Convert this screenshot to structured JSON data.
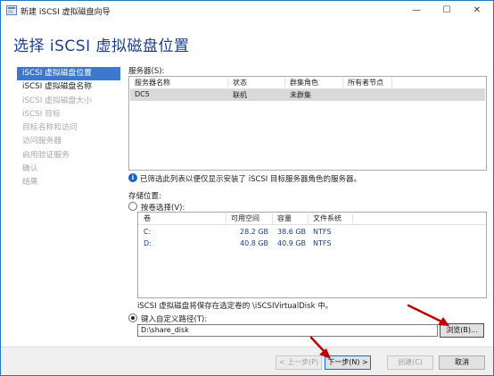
{
  "window": {
    "title": "新建 iSCSI 虚拟磁盘向导",
    "minimize_glyph": "—",
    "maximize_glyph": "☐",
    "close_glyph": "✕"
  },
  "page_title": "选择 iSCSI 虚拟磁盘位置",
  "nav": {
    "items": [
      {
        "label": "iSCSI 虚拟磁盘位置",
        "state": "active"
      },
      {
        "label": "iSCSI 虚拟磁盘名称",
        "state": "enabled"
      },
      {
        "label": "iSCSI 虚拟磁盘大小",
        "state": "disabled"
      },
      {
        "label": "iSCSI 目标",
        "state": "disabled"
      },
      {
        "label": "目标名称和访问",
        "state": "disabled"
      },
      {
        "label": "访问服务器",
        "state": "disabled"
      },
      {
        "label": "启用验证服务",
        "state": "disabled"
      },
      {
        "label": "确认",
        "state": "disabled"
      },
      {
        "label": "结果",
        "state": "disabled"
      }
    ]
  },
  "servers": {
    "label": "服务器(S):",
    "columns": [
      "服务器名称",
      "状态",
      "群集角色",
      "所有者节点"
    ],
    "rows": [
      [
        "DC5",
        "联机",
        "未群集",
        ""
      ]
    ],
    "info_text": "已筛选此列表以便仅显示安装了 iSCSI 目标服务器角色的服务器。"
  },
  "storage": {
    "label": "存储位置:",
    "by_volume_label": "按卷选择(V):",
    "by_volume_selected": false,
    "volume_columns": [
      "卷",
      "可用空间",
      "容量",
      "文件系统"
    ],
    "volumes": [
      [
        "C:",
        "28.2 GB",
        "38.6 GB",
        "NTFS"
      ],
      [
        "D:",
        "40.8 GB",
        "40.9 GB",
        "NTFS"
      ]
    ],
    "volume_note": "iSCSI 虚拟磁盘将保存在选定卷的 \\iSCSIVirtualDisk 中。",
    "custom_path_label": "键入自定义路径(T):",
    "custom_path_selected": true,
    "custom_path_value": "D:\\share_disk",
    "browse_label": "浏览(B)..."
  },
  "buttons": {
    "prev": "< 上一步(P)",
    "next": "下一步(N) >",
    "create": "创建(C)",
    "cancel": "取消"
  },
  "colors": {
    "accent": "#3c78cc",
    "title": "#1a3f8f",
    "annotation_arrow": "#c00000"
  }
}
